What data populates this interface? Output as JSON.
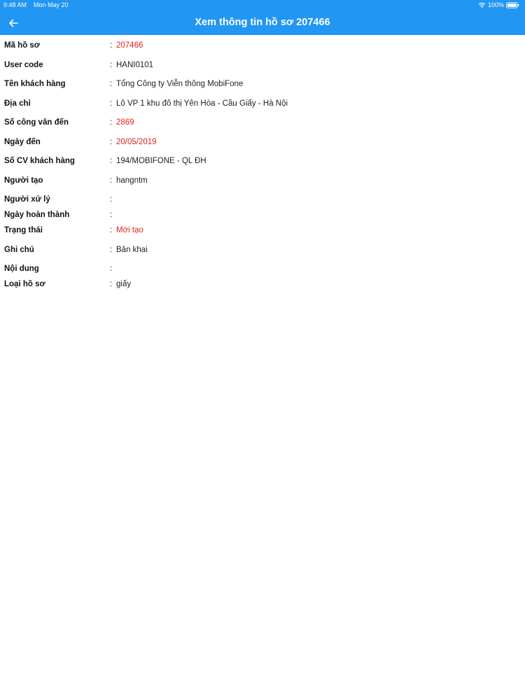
{
  "status_bar": {
    "time": "9:48 AM",
    "date": "Mon May 20",
    "battery": "100%"
  },
  "header": {
    "title": "Xem thông tin hồ sơ 207466"
  },
  "colors": {
    "primary": "#2196f3",
    "highlight": "#e02020"
  },
  "fields": [
    {
      "label": "Mã hồ sơ",
      "value": "207466",
      "highlight": true
    },
    {
      "label": "User code",
      "value": "HANI0101",
      "highlight": false
    },
    {
      "label": "Tên khách hàng",
      "value": "Tổng Công ty Viễn thông MobiFone",
      "highlight": false
    },
    {
      "label": "Địa chỉ",
      "value": "Lô VP 1 khu đô thị Yên Hòa - Cầu Giấy - Hà Nội",
      "highlight": false
    },
    {
      "label": "Số công văn đến",
      "value": "2869",
      "highlight": true
    },
    {
      "label": "Ngày đến",
      "value": "20/05/2019",
      "highlight": true
    },
    {
      "label": "Số CV khách hàng",
      "value": "194/MOBIFONE - QL ĐH",
      "highlight": false
    },
    {
      "label": "Người tạo",
      "value": "hangntm",
      "highlight": false
    },
    {
      "label": "Người xử lý",
      "value": "",
      "highlight": false
    },
    {
      "label": "Ngày hoàn thành",
      "value": "",
      "highlight": false
    },
    {
      "label": "Trạng thái",
      "value": "Mới tạo",
      "highlight": true
    },
    {
      "label": "Ghi chú",
      "value": "Bản khai",
      "highlight": false
    },
    {
      "label": "Nội dung",
      "value": "",
      "highlight": false
    },
    {
      "label": "Loại hồ sơ",
      "value": "giấy",
      "highlight": false
    }
  ]
}
